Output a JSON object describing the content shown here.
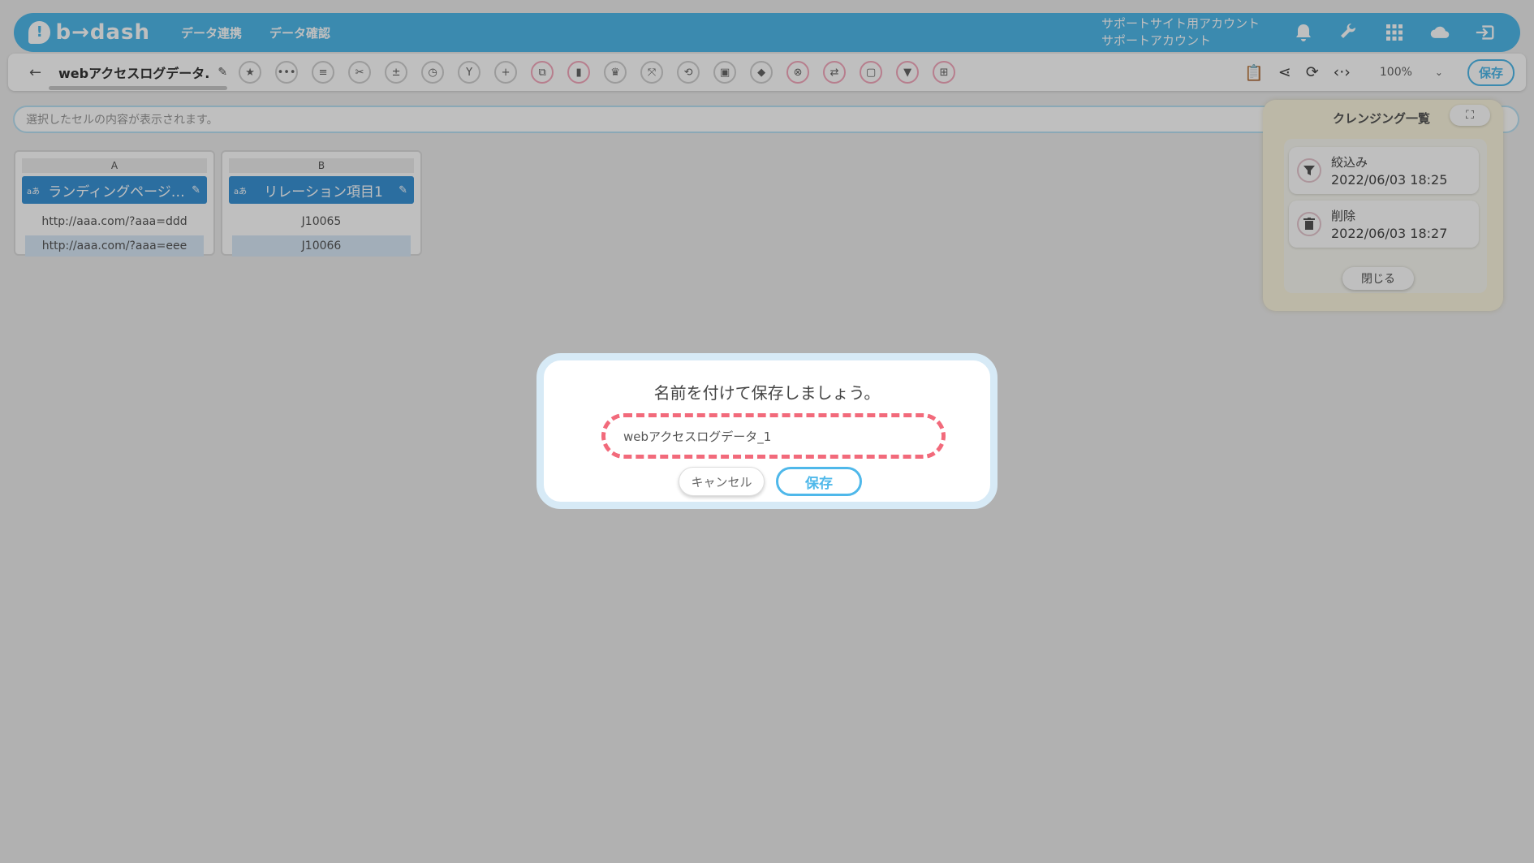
{
  "header": {
    "logo_mark": "!",
    "logo_text": "b→dash",
    "nav": [
      "データ連携",
      "データ確認"
    ],
    "account_line1": "サポートサイト用アカウント",
    "account_line2": "サポートアカウント",
    "icons": [
      "bell-icon",
      "wrench-icon",
      "grid-icon",
      "cloud-icon",
      "logout-icon"
    ]
  },
  "toolbar": {
    "back_glyph": "←",
    "doc_title": "webアクセスログデータ.",
    "zoom": "100%",
    "save_label": "保存"
  },
  "cellbar": {
    "placeholder": "選択したセルの内容が表示されます。"
  },
  "columns": [
    {
      "letter": "A",
      "type": "aあ",
      "name": "ランディングページ…",
      "cells": [
        "http://aaa.com/?aaa=ddd",
        "http://aaa.com/?aaa=eee"
      ]
    },
    {
      "letter": "B",
      "type": "aあ",
      "name": "リレーション項目1",
      "cells": [
        "J10065",
        "J10066"
      ]
    }
  ],
  "panel": {
    "title": "クレンジング一覧",
    "steps": [
      {
        "name": "絞込み",
        "date": "2022/06/03 18:25",
        "icon": "filter-icon"
      },
      {
        "name": "削除",
        "date": "2022/06/03 18:27",
        "icon": "trash-icon"
      }
    ],
    "close_label": "閉じる"
  },
  "modal": {
    "title": "名前を付けて保存しましょう。",
    "input_value": "webアクセスログデータ_1",
    "cancel_label": "キャンセル",
    "save_label": "保存"
  }
}
